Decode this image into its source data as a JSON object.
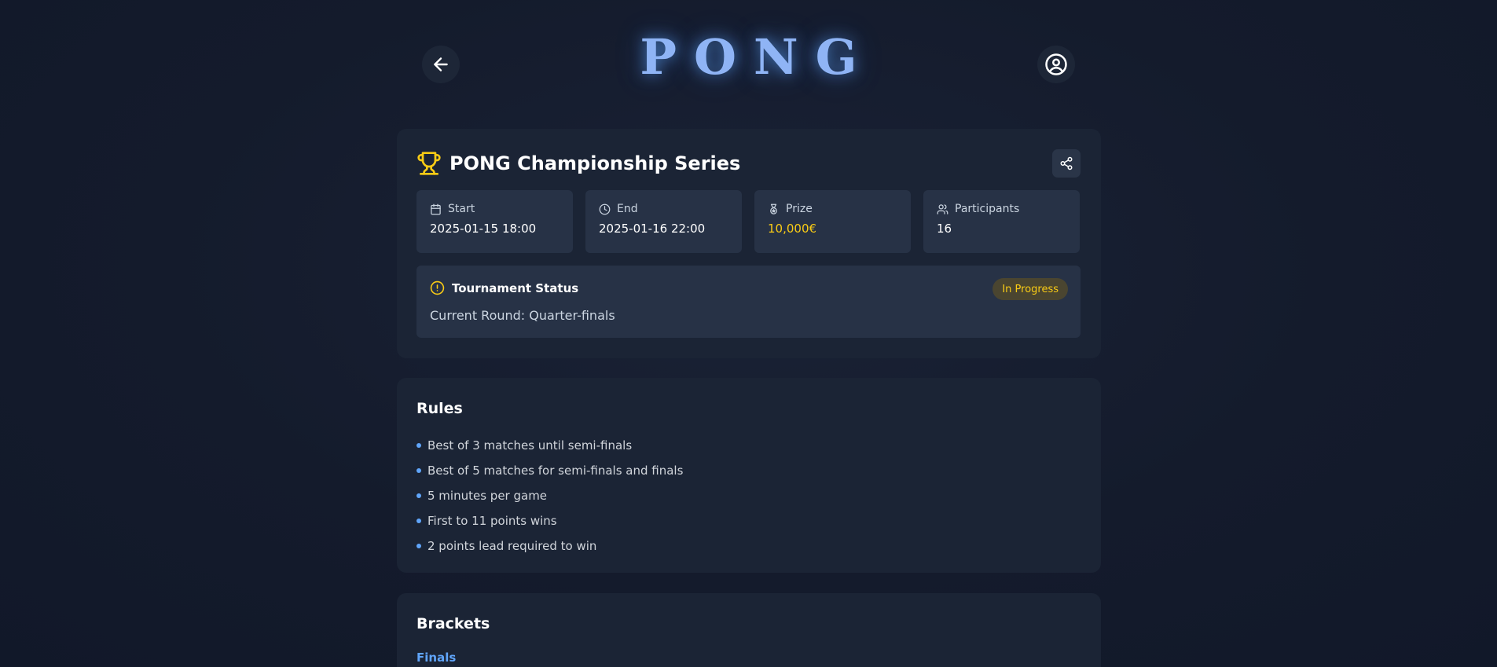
{
  "header": {
    "logo": "PONG",
    "back_icon": "arrow-left-icon",
    "profile_icon": "user-circle-icon"
  },
  "tournament": {
    "title": "PONG Championship Series",
    "title_icon": "trophy-icon",
    "share_icon": "share-icon",
    "stats": [
      {
        "label": "Start",
        "value": "2025-01-15 18:00",
        "icon": "calendar-icon"
      },
      {
        "label": "End",
        "value": "2025-01-16 22:00",
        "icon": "clock-icon"
      },
      {
        "label": "Prize",
        "value": "10,000€",
        "icon": "medal-icon"
      },
      {
        "label": "Participants",
        "value": "16",
        "icon": "users-icon"
      }
    ],
    "status": {
      "title": "Tournament Status",
      "badge": "In Progress",
      "current_round": "Current Round: Quarter-finals",
      "icon": "alert-circle-icon"
    }
  },
  "rules": {
    "title": "Rules",
    "items": [
      "Best of 3 matches until semi-finals",
      "Best of 5 matches for semi-finals and finals",
      "5 minutes per game",
      "First to 11 points wins",
      "2 points lead required to win"
    ]
  },
  "brackets": {
    "title": "Brackets",
    "round_label": "Finals"
  },
  "colors": {
    "accent": "#60a5fa",
    "gold": "#facc15",
    "card": "#1b2435",
    "tile": "#273246"
  }
}
